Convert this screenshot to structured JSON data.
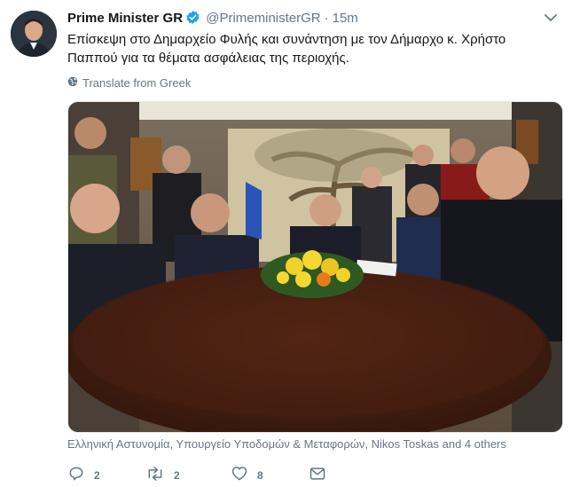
{
  "tweet": {
    "author_name": "Prime Minister GR",
    "verified": true,
    "handle": "@PrimeministerGR",
    "separator": "·",
    "time": "15m",
    "text": "Επίσκεψη στο Δημαρχείο Φυλής και συνάντηση με τον Δήμαρχο κ. Χρήστο Παππού για τα θέματα ασφάλειας της περιοχής.",
    "translate_label": "Translate from Greek",
    "tagged_people": "Ελληνική Αστυνομία, Υπουργείο Υποδομών & Μεταφορών, Nikos Toskas and 4 others"
  },
  "actions": {
    "reply_count": "2",
    "retweet_count": "2",
    "like_count": "8"
  },
  "icons": {
    "verified": "verified-badge-icon",
    "caret": "chevron-down-icon",
    "globe": "globe-icon",
    "reply": "reply-icon",
    "retweet": "retweet-icon",
    "like": "heart-icon",
    "dm": "envelope-icon"
  },
  "colors": {
    "accent": "#1da1f2",
    "secondary_text": "#657786",
    "primary_text": "#14171a"
  }
}
